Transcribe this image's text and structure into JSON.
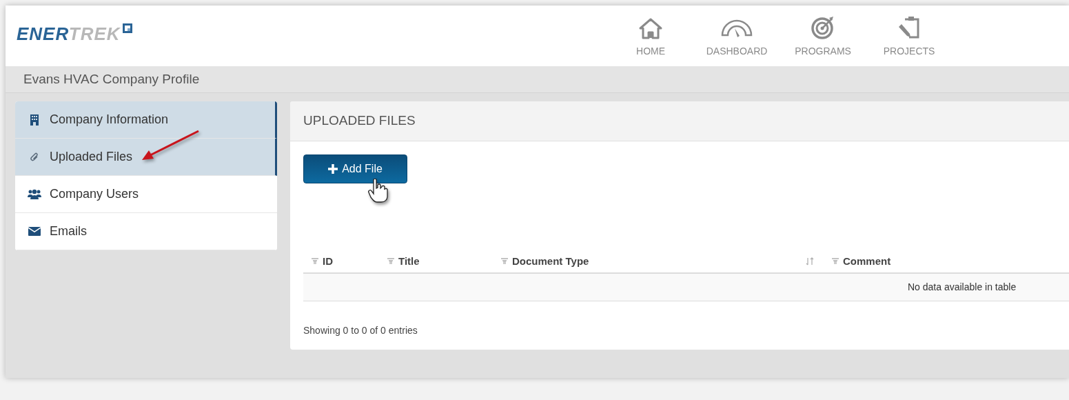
{
  "logo": {
    "primary": "ENER",
    "secondary": "TREK"
  },
  "nav": [
    {
      "label": "HOME",
      "kind": "home"
    },
    {
      "label": "DASHBOARD",
      "kind": "dashboard"
    },
    {
      "label": "PROGRAMS",
      "kind": "programs"
    },
    {
      "label": "PROJECTS",
      "kind": "projects"
    }
  ],
  "page_title": "Evans HVAC Company Profile",
  "sidebar": {
    "items": [
      {
        "label": "Company Information",
        "kind": "building",
        "selected": true
      },
      {
        "label": "Uploaded Files",
        "kind": "paperclip",
        "selected": true
      },
      {
        "label": "Company Users",
        "kind": "users",
        "selected": false
      },
      {
        "label": "Emails",
        "kind": "envelope",
        "selected": false
      }
    ]
  },
  "panel": {
    "title": "UPLOADED FILES",
    "add_button": "Add File",
    "table": {
      "columns": [
        {
          "label": "ID",
          "kind": "filter"
        },
        {
          "label": "Title",
          "kind": "filter"
        },
        {
          "label": "Document Type",
          "kind": "filter"
        },
        {
          "label": "Comment",
          "kind": "sort-filter"
        }
      ],
      "empty_message": "No data available in table"
    },
    "footer": "Showing 0 to 0 of 0 entries"
  }
}
